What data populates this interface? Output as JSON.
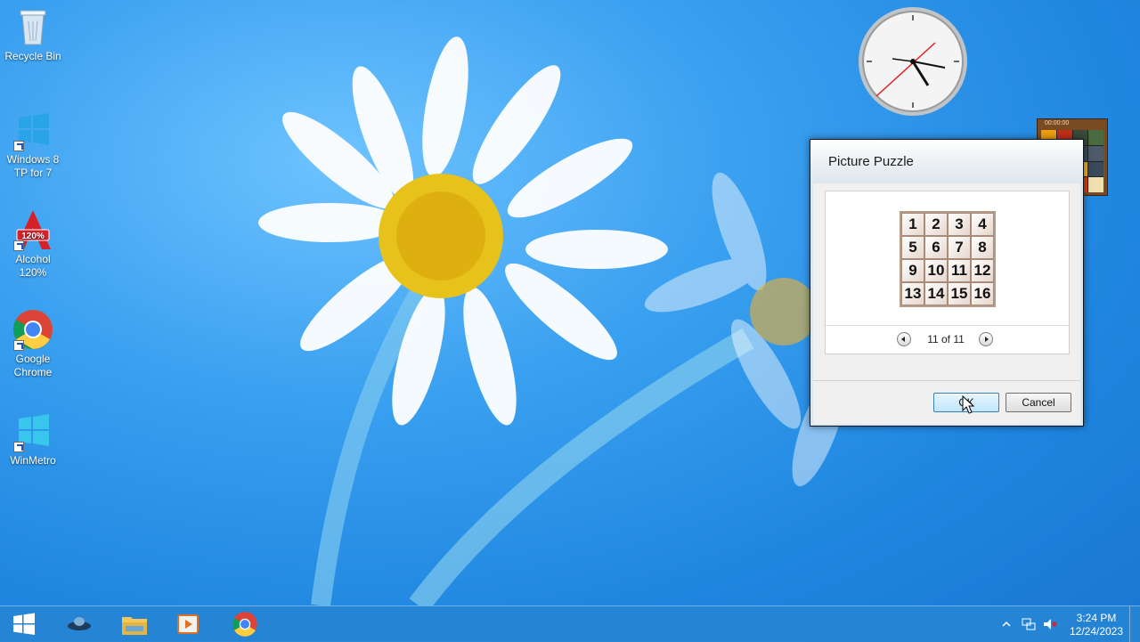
{
  "desktop": {
    "icons": [
      {
        "label": "Recycle Bin",
        "icon": "recycle-bin-icon"
      },
      {
        "label": "Windows 8 TP for 7",
        "icon": "windows-logo-icon"
      },
      {
        "label": "Alcohol 120%",
        "icon": "alcohol-120-icon"
      },
      {
        "label": "Google Chrome",
        "icon": "chrome-icon"
      },
      {
        "label": "WinMetro",
        "icon": "winmetro-icon"
      }
    ]
  },
  "gadgets": {
    "clock": {
      "icon": "analog-clock-icon"
    },
    "puzzle": {
      "timer": "00:00:00",
      "icon": "picture-puzzle-gadget"
    }
  },
  "dialog": {
    "title": "Picture Puzzle",
    "puzzle_numbers": [
      "1",
      "2",
      "3",
      "4",
      "5",
      "6",
      "7",
      "8",
      "9",
      "10",
      "11",
      "12",
      "13",
      "14",
      "15",
      "16"
    ],
    "nav_text": "11 of 11",
    "ok_label": "OK",
    "cancel_label": "Cancel"
  },
  "taskbar": {
    "apps": [
      "start-button",
      "ufo-app-icon",
      "file-explorer-icon",
      "media-player-icon",
      "chrome-icon"
    ],
    "time": "3:24 PM",
    "date": "12/24/2023"
  },
  "colors": {
    "taskbar": "#2684d2",
    "ok_button": "#bee6fd",
    "desktop": "#1f86e0"
  }
}
